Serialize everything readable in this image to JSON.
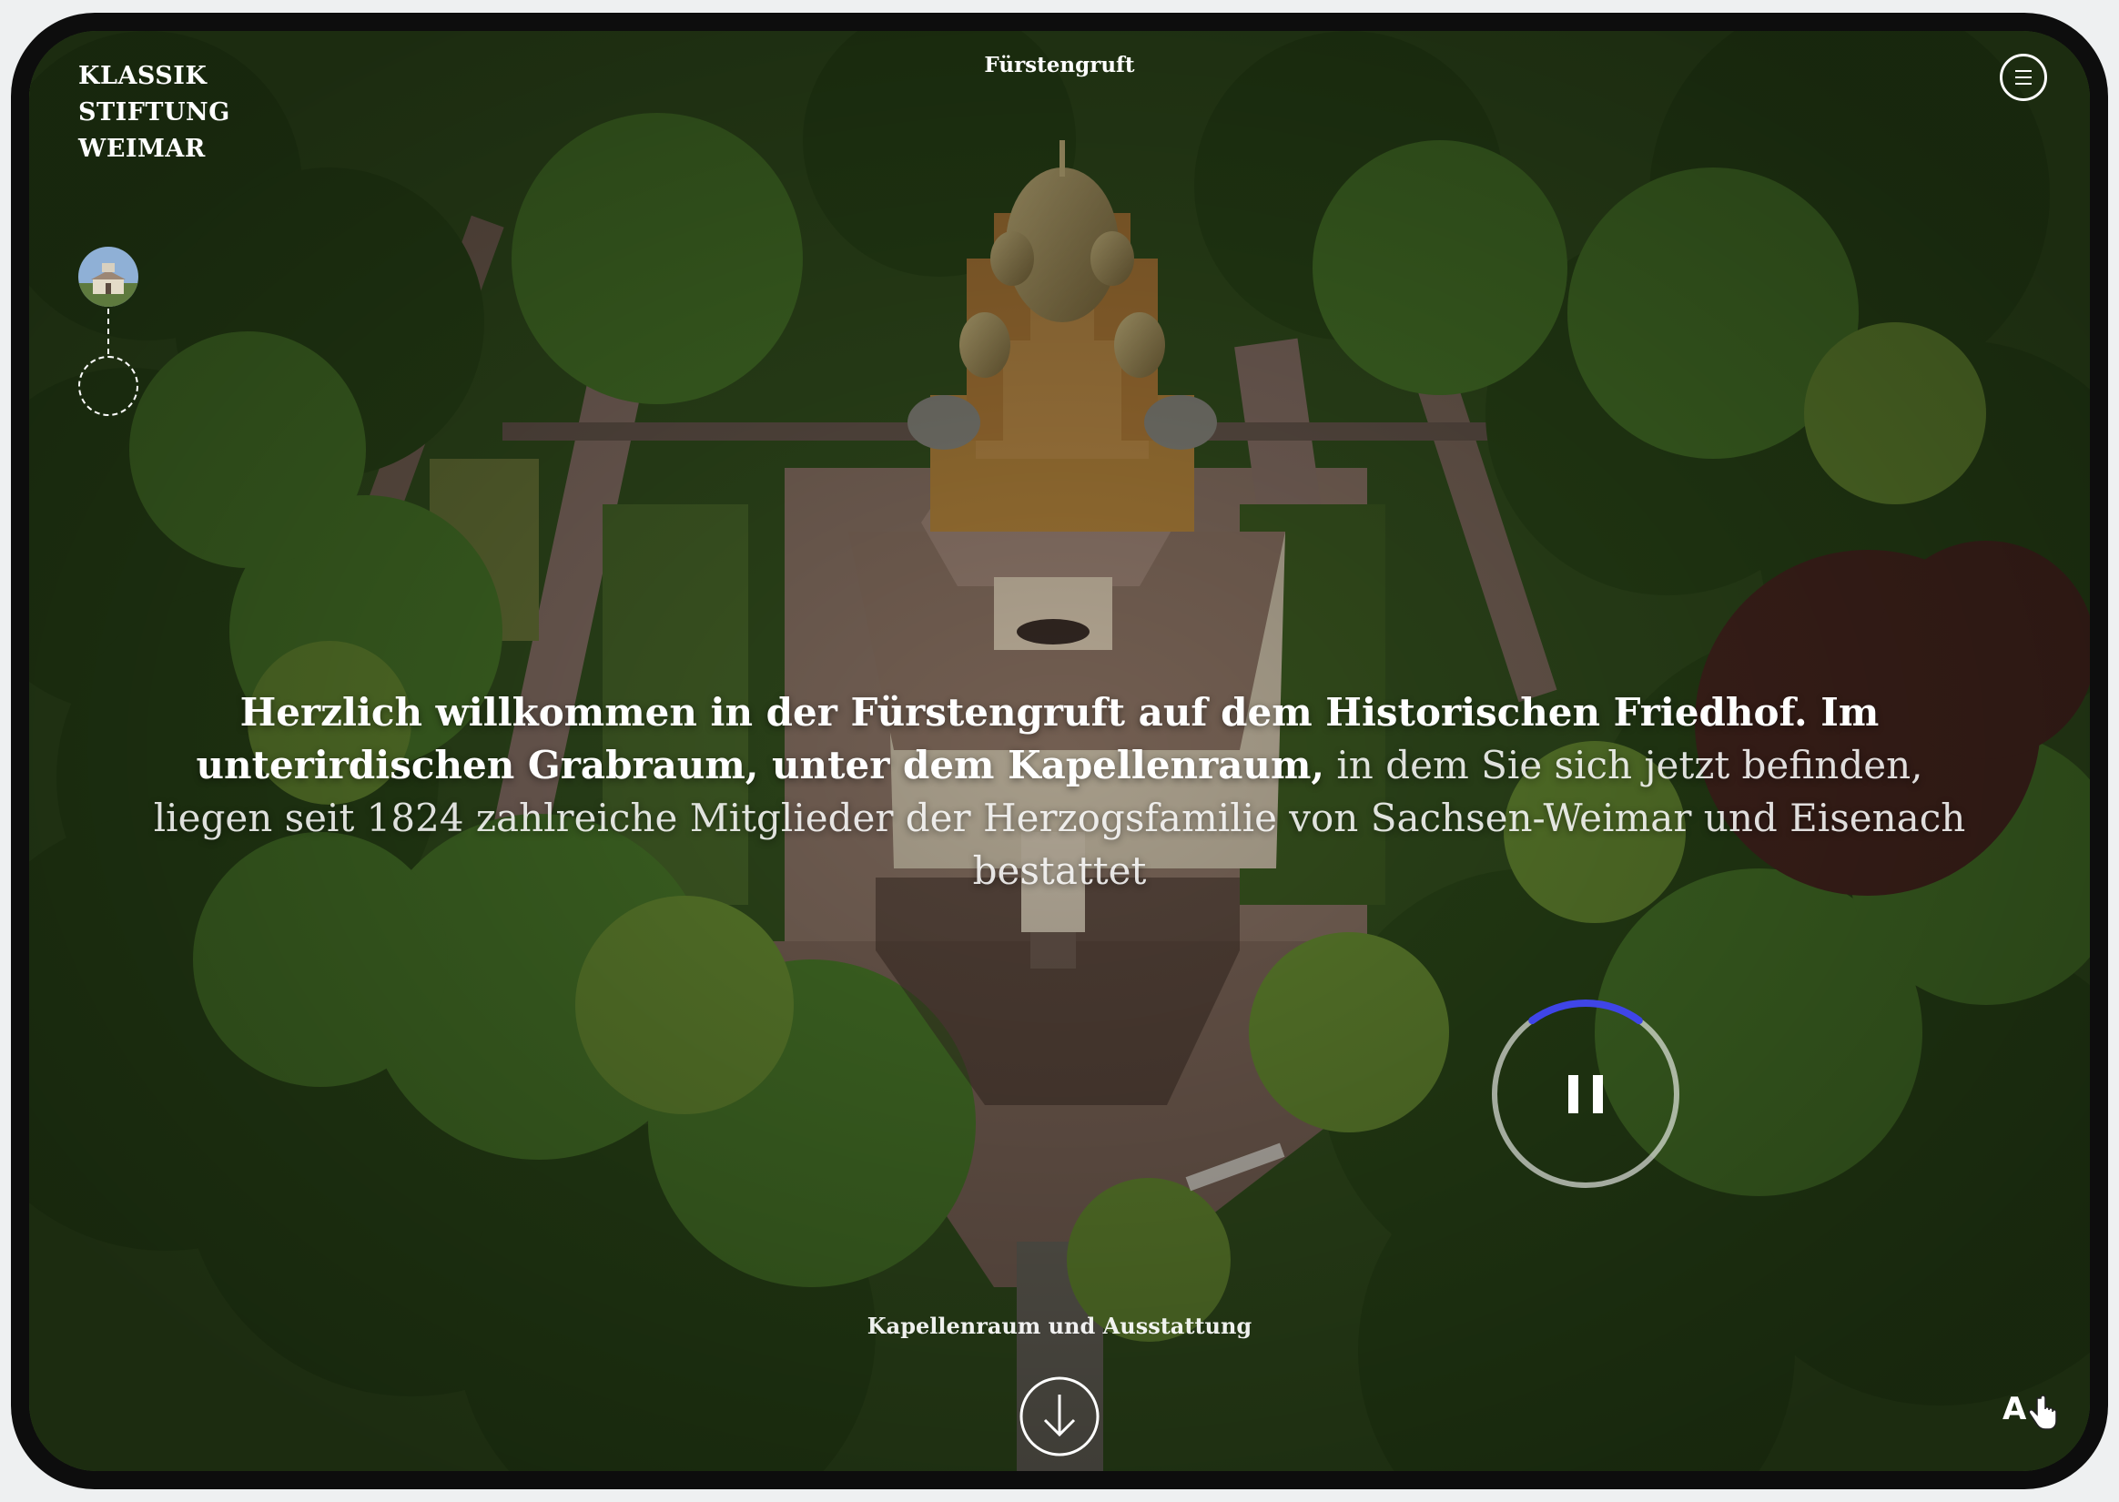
{
  "brand": {
    "line1": "KLASSIK",
    "line2": "STIFTUNG",
    "line3": "WEIMAR"
  },
  "header": {
    "title": "Fürstengruft"
  },
  "narration": {
    "spoken": "Herzlich willkommen in der Fürstengruft auf dem Historischen Friedhof. Im unterirdischen Grabraum, unter dem Kapellenraum,",
    "pending": " in dem Sie sich jetzt befinden, liegen seit 1824 zahlreiche Mitglieder der Herzogsfamilie von Sachsen-Weimar und Eisenach bestattet"
  },
  "audio": {
    "state": "playing",
    "progress": 0.2,
    "progress_color": "#3f45e8"
  },
  "navigation": {
    "next_chapter": "Kapellenraum und Ausstattung"
  },
  "accessibility": {
    "label": "A"
  },
  "icons": {
    "menu": "menu-icon",
    "pause": "pause-icon",
    "arrow_down": "arrow-down-icon",
    "hand": "hand-pointer-icon",
    "thumbnail": "mausoleum-thumbnail"
  }
}
